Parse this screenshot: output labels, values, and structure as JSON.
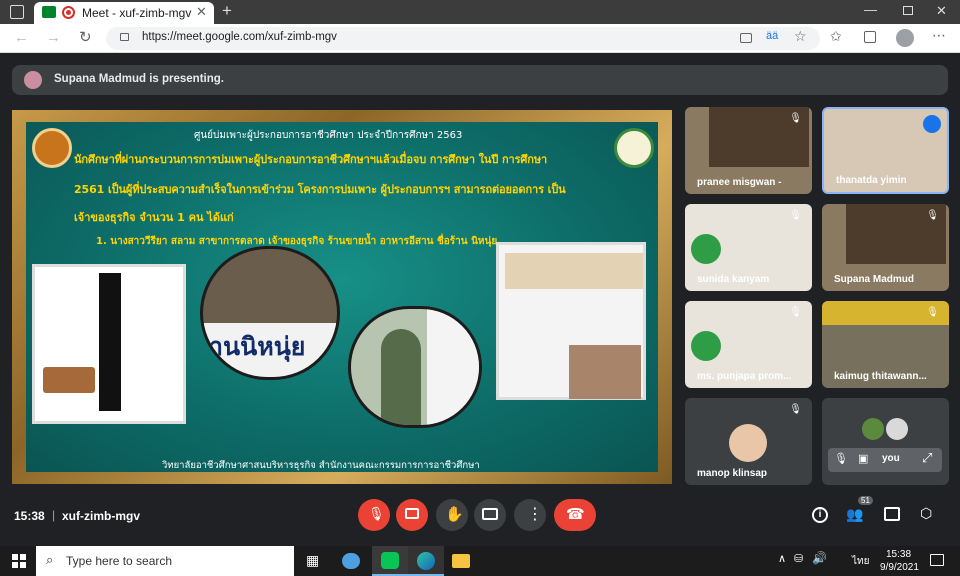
{
  "browser": {
    "tab_title": "Meet - xuf-zimb-mgv",
    "url": "https://meet.google.com/xuf-zimb-mgv",
    "translate_icon_text": "ää"
  },
  "meet": {
    "presenting_banner": "Supana Madmud is presenting.",
    "slide": {
      "header": "ศูนย์บ่มเพาะผู้ประกอบการอาชีวศึกษา  ประจำปีการศึกษา 2563",
      "line1": "นักศึกษาที่ผ่านกระบวนการการบ่มเพาะผู้ประกอบการอาชีวศึกษาฯแล้วเมื่อจบ การศึกษา ในปี การศึกษา",
      "line2": "2561 เป็นผู้ที่ประสบความสำเร็จในการเข้าร่วม โครงการบ่มเพาะ ผู้ประกอบการฯ สามารถต่อยอดการ เป็น",
      "line3": "เจ้าของธุรกิจ จำนวน 1 คน  ได้แก่",
      "line4": "1. นางสาววีรียา      สลาม  สาขาการตลาด เจ้าของธุรกิจ  ร้านขายน้ำ   อาหารอีสาน ชื่อร้าน นิหนุ่ย",
      "shop_sign": "านนิหนุ่ย",
      "footer": "วิทยาลัยอาชีวศึกษาศาสนบริหารธุรกิจ   สำนักงานคณะกรรมการการอาชีวศึกษา"
    },
    "participants": [
      {
        "name": "pranee misgwan -"
      },
      {
        "name": "thanatda yimin"
      },
      {
        "name": "sunida kanyam"
      },
      {
        "name": "Supana Madmud"
      },
      {
        "name": "ms. punjapa prom..."
      },
      {
        "name": "kaimug thitawann..."
      },
      {
        "name": "manop klinsap"
      },
      {
        "name": "you"
      }
    ],
    "bottom": {
      "time": "15:38",
      "meeting_code": "xuf-zimb-mgv",
      "participants_count": "51"
    }
  },
  "taskbar": {
    "search_placeholder": "Type here to search",
    "clock_time": "15:38",
    "clock_date": "9/9/2021",
    "language": "ไทย"
  },
  "colors": {
    "meet_bg": "#202124",
    "tile_bg": "#3c4043",
    "end_call_red": "#ea4335",
    "active_speaker_blue": "#8ab4f8",
    "slide_text_yellow": "#ffd400"
  }
}
